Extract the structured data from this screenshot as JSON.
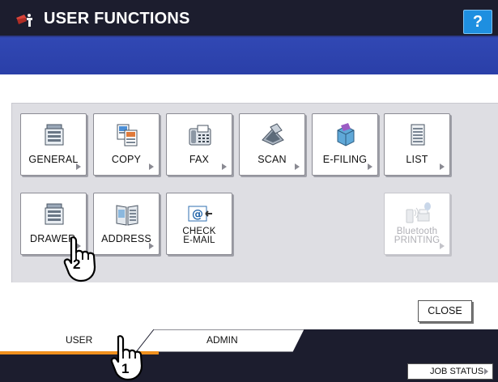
{
  "titlebar": {
    "title": "USER FUNCTIONS",
    "help_label": "?",
    "icon": "user-functions-icon"
  },
  "functions": [
    {
      "label": "GENERAL",
      "icon": "general-copier-icon",
      "enabled": true
    },
    {
      "label": "COPY",
      "icon": "copy-icon",
      "enabled": true
    },
    {
      "label": "FAX",
      "icon": "fax-icon",
      "enabled": true
    },
    {
      "label": "SCAN",
      "icon": "scan-icon",
      "enabled": true
    },
    {
      "label": "E-FILING",
      "icon": "e-filing-icon",
      "enabled": true
    },
    {
      "label": "LIST",
      "icon": "list-icon",
      "enabled": true
    },
    {
      "label": "DRAWER",
      "icon": "drawer-icon",
      "enabled": true
    },
    {
      "label": "ADDRESS",
      "icon": "address-book-icon",
      "enabled": true
    },
    {
      "label_line1": "CHECK",
      "label_line2": "E-MAIL",
      "icon": "check-email-icon",
      "enabled": true
    },
    {
      "label_line1": "Bluetooth",
      "label_line2": "PRINTING",
      "icon": "bluetooth-printing-icon",
      "enabled": false
    }
  ],
  "close_label": "CLOSE",
  "tabs": {
    "user": "USER",
    "admin": "ADMIN",
    "active": "USER"
  },
  "job_status_label": "JOB STATUS",
  "callouts": [
    {
      "number": "1"
    },
    {
      "number": "2"
    }
  ],
  "colors": {
    "titlebar": "#1c1d2e",
    "blueband": "#2f45b0",
    "help": "#1e8fe0",
    "panel": "#dedee3",
    "active_tab_line": "#f0901e"
  }
}
